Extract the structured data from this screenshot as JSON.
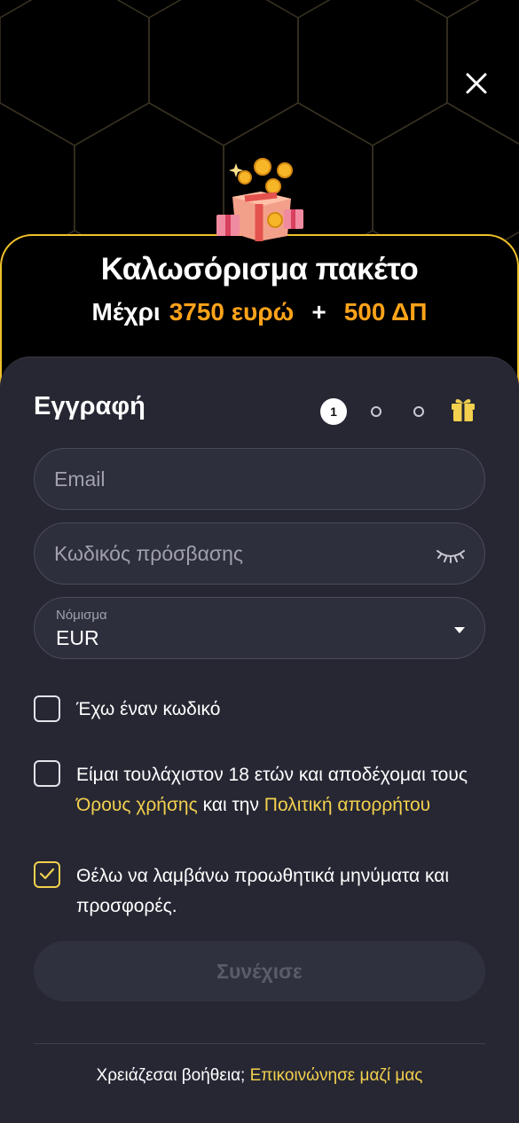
{
  "promo": {
    "title": "Καλωσόρισμα πακέτο",
    "prefix": "Μέχρι",
    "amount": "3750 ευρώ",
    "plus": "+",
    "spins": "500 ΔΠ"
  },
  "registration": {
    "title": "Εγγραφή",
    "active_step": "1"
  },
  "form": {
    "email_placeholder": "Email",
    "password_placeholder": "Κωδικός πρόσβασης",
    "currency_label": "Νόμισμα",
    "currency_value": "EUR"
  },
  "checks": {
    "promo_code": "Έχω έναν κωδικό",
    "terms_prefix": "Είμαι τουλάχιστον 18 ετών και αποδέχομαι τους",
    "terms_link": "Όρους χρήσης",
    "terms_middle": "και την",
    "privacy_link": "Πολιτική απορρήτου",
    "marketing": "Θέλω να λαμβάνω προωθητικά μηνύματα και προσφορές.",
    "marketing_checked": true
  },
  "continue_label": "Συνέχισε",
  "help": {
    "text": "Χρειάζεσαι βοήθεια;",
    "link": "Επικοινώνησε μαζί μας"
  },
  "colors": {
    "accent_orange": "#ffa31a",
    "accent_yellow": "#f3d04e",
    "card_bg": "#262733"
  }
}
